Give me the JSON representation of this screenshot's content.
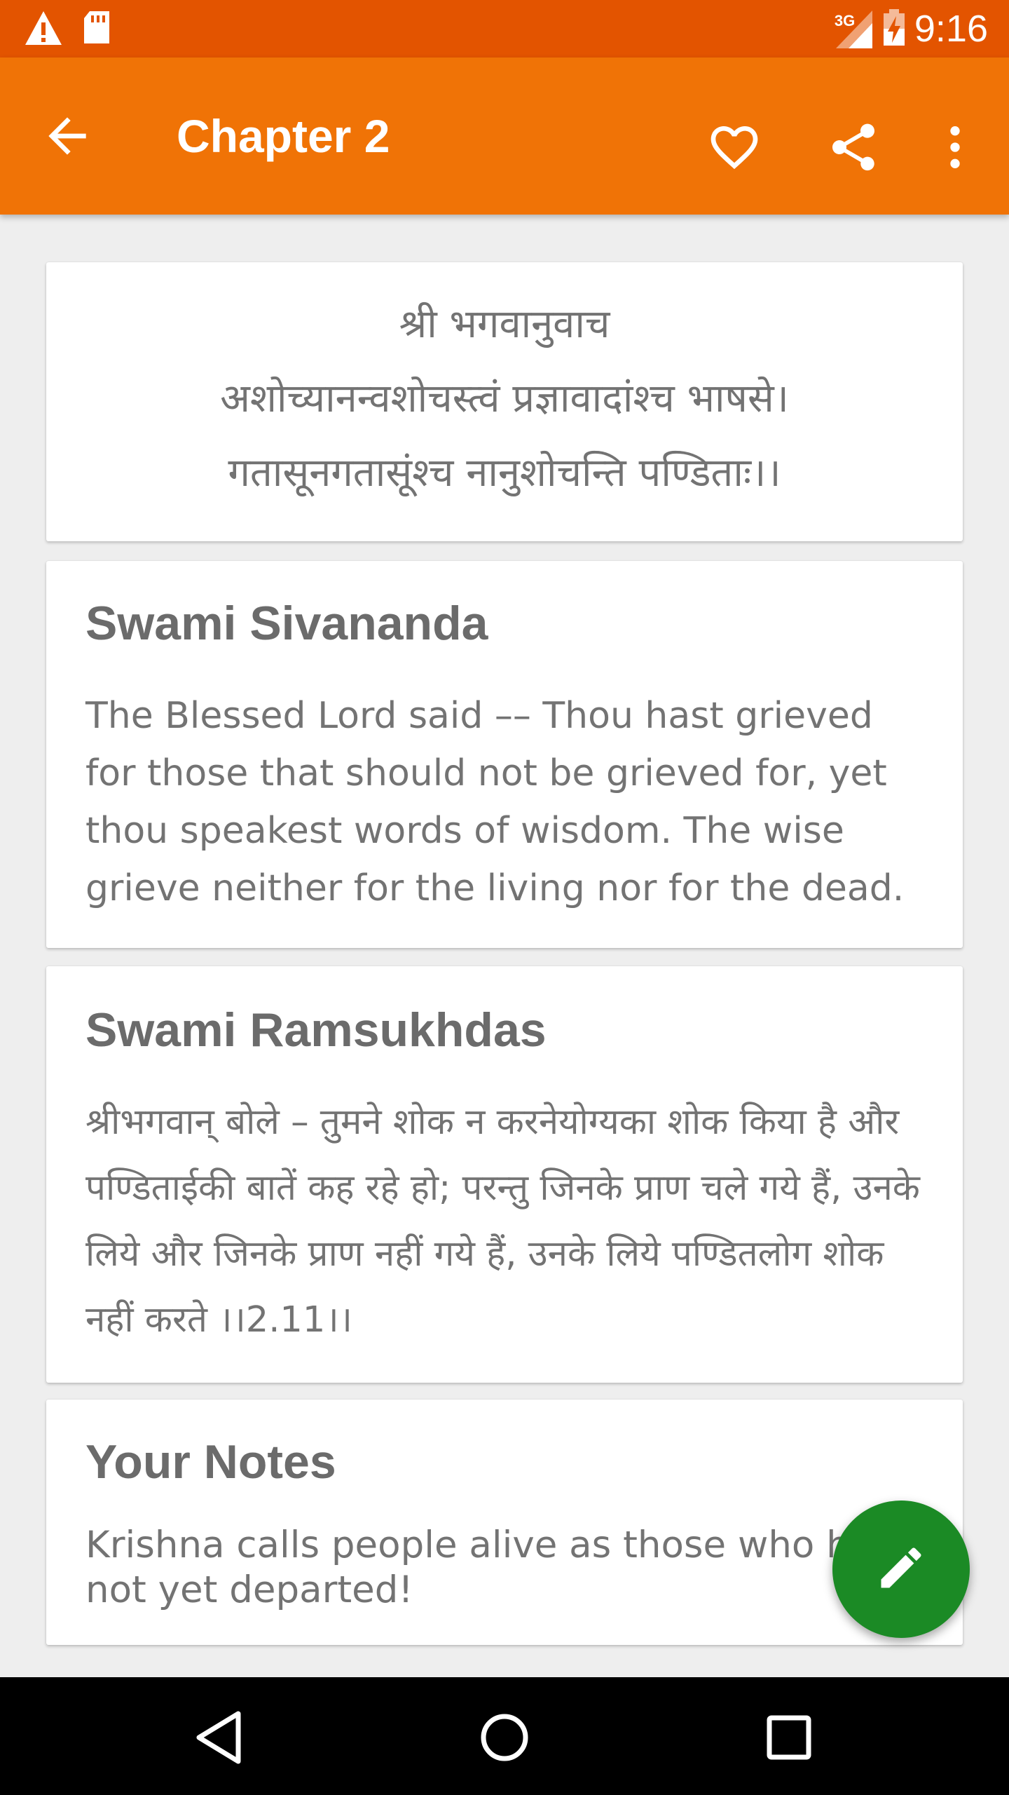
{
  "status_bar": {
    "time": "9:16",
    "network": "3G",
    "icons": [
      "warning-icon",
      "sd-card-icon",
      "signal-icon",
      "battery-charging-icon"
    ]
  },
  "app_bar": {
    "title": "Chapter 2",
    "actions": [
      "back-arrow-icon",
      "heart-icon",
      "share-icon",
      "more-vert-icon"
    ]
  },
  "verse": {
    "lines": [
      "श्री भगवानुवाच",
      "अशोच्यानन्वशोचस्त्वं प्रज्ञावादांश्च भाषसे।",
      "गतासूनगतासूंश्च नानुशोचन्ति पण्डिताः।।"
    ]
  },
  "translations": {
    "sivananda": {
      "title": "Swami Sivananda",
      "text": "The Blessed Lord said –– Thou hast grieved for those that should not be grieved for, yet thou speakest words of wisdom. The wise grieve neither for the living nor for the dead."
    },
    "ramsukhdas": {
      "title": "Swami Ramsukhdas",
      "text": "श्रीभगवान् बोले – तुमने शोक न करनेयोग्यका शोक किया है और पण्डिताईकी बातें कह रहे हो; परन्तु जिनके प्राण चले गये हैं, उनके लिये और जिनके प्राण नहीं गये हैं, उनके लिये पण्डितलोग शोक नहीं करते ।।2.11।।"
    }
  },
  "notes": {
    "title": "Your Notes",
    "text": "Krishna calls people alive as those who have not yet departed!"
  },
  "fab": {
    "icon": "edit-pencil-icon"
  },
  "nav_bar": {
    "icons": [
      "nav-back-icon",
      "nav-home-icon",
      "nav-recents-icon"
    ]
  },
  "colors": {
    "status_bar": "#e35400",
    "app_bar": "#f07306",
    "fab": "#1b8a25",
    "text": "#737373"
  }
}
